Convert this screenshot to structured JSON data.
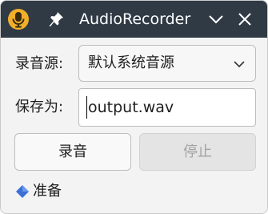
{
  "window": {
    "title": "AudioRecorder",
    "app_icon": "microphone-icon",
    "pin_icon": "pin-icon",
    "minimize_icon": "chevron-down-icon",
    "close_icon": "close-icon",
    "titlebar_color": "#2f3a45",
    "app_icon_color": "#f2b02a"
  },
  "form": {
    "source_label": "录音源:",
    "source_value": "默认系统音源",
    "save_label": "保存为:",
    "save_value": "output.wav"
  },
  "buttons": {
    "record_label": "录音",
    "stop_label": "停止"
  },
  "status": {
    "icon": "blue-diamond-icon",
    "text": "准备",
    "icon_color": "#3b6fd6"
  }
}
